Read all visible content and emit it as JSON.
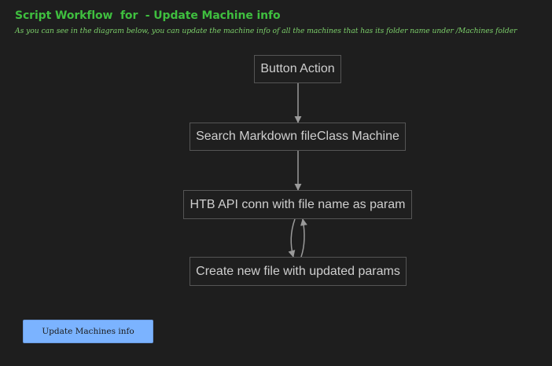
{
  "header": {
    "title": "Script Workflow  for  - Update Machine info",
    "subtitle": "As you can see in the diagram below, you can update the machine info of all the machines that has its folder name under /Machines folder"
  },
  "diagram": {
    "nodes": [
      "Button Action",
      "Search Markdown fileClass Machine",
      "HTB API conn with file name as param",
      "Create new file with updated params"
    ]
  },
  "actions": {
    "update_button_label": "Update Machines info"
  },
  "colors": {
    "background": "#1e1e1e",
    "title": "#3fbf3f",
    "subtitle": "#7ccf6a",
    "node_border": "#555555",
    "node_text": "#cfcfcf",
    "edge": "#9a9a9a",
    "button_bg": "#7bb3ff"
  }
}
